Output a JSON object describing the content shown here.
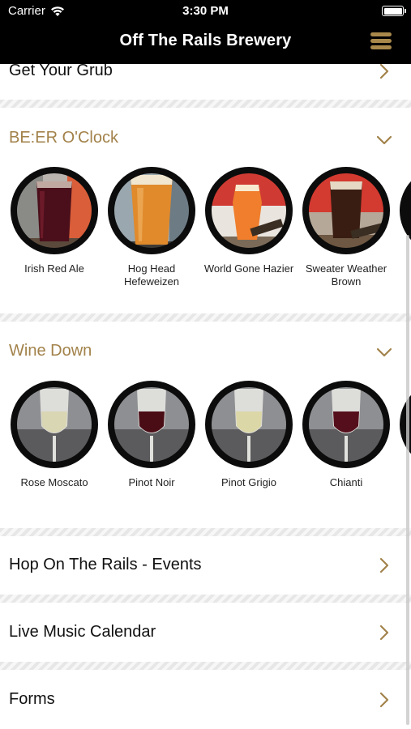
{
  "status_bar": {
    "carrier": "Carrier",
    "time": "3:30 PM"
  },
  "nav": {
    "title": "Off The Rails Brewery",
    "menu_icon": "hamburger-menu-icon"
  },
  "rows": {
    "grub": "Get Your Grub",
    "events": "Hop On The Rails - Events",
    "music": "Live Music Calendar",
    "forms": "Forms"
  },
  "beer_section": {
    "title": "BE:ER O'Clock",
    "items": [
      {
        "name": "Irish Red Ale"
      },
      {
        "name": "Hog Head Hefeweizen"
      },
      {
        "name": "World Gone Hazier"
      },
      {
        "name": "Sweater Weather Brown"
      }
    ]
  },
  "wine_section": {
    "title": "Wine Down",
    "items": [
      {
        "name": "Rose Moscato"
      },
      {
        "name": "Pinot Noir"
      },
      {
        "name": "Pinot Grigio"
      },
      {
        "name": "Chianti"
      }
    ]
  },
  "colors": {
    "accent": "#a2824a",
    "nav_bg": "#000000",
    "divider": "#e7e7e7"
  }
}
